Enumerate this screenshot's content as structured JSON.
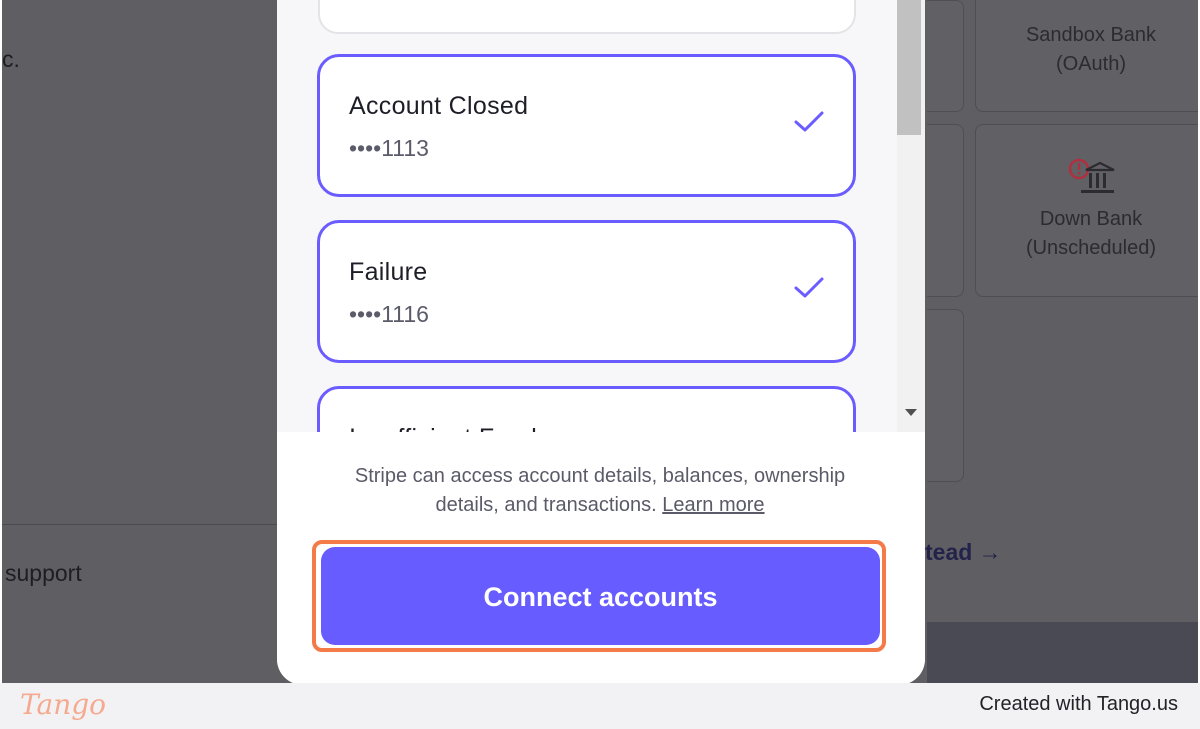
{
  "background": {
    "partial_text_top": "c.",
    "partial_text_support": "support",
    "instead_link": "tead →",
    "banks": [
      {
        "name_line1": "Sandbox Bank",
        "name_line2": "(OAuth)"
      },
      {
        "name_line1": "Down Bank",
        "name_line2": "(Unscheduled)"
      }
    ]
  },
  "modal": {
    "accounts": [
      {
        "name": "Account Closed",
        "mask": "••••1113",
        "selected": true
      },
      {
        "name": "Failure",
        "mask": "••••1116",
        "selected": true
      },
      {
        "name": "Insufficient Funds",
        "mask": "",
        "selected": false
      }
    ],
    "consent_text": "Stripe can access account details, balances, ownership details, and transactions.",
    "learn_more": "Learn more",
    "connect_button": "Connect accounts"
  },
  "tango": {
    "logo": "Tango",
    "credit": "Created with Tango.us"
  },
  "colors": {
    "accent": "#665cff",
    "highlight": "#f47a48",
    "overlay": "#5f5f63"
  }
}
